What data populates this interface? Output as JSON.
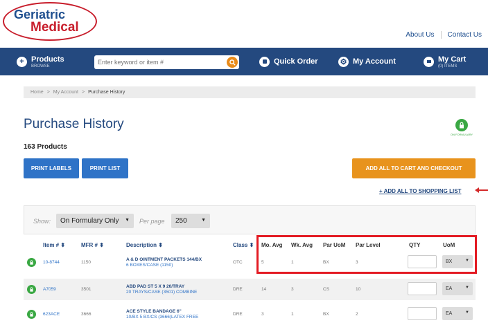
{
  "brand": {
    "line1": "Geriatric",
    "line2": "Medical"
  },
  "top_links": [
    "About Us",
    "Contact Us"
  ],
  "nav": {
    "products": {
      "label": "Products",
      "sub": "BROWSE"
    },
    "search_placeholder": "Enter keyword or item #",
    "quick_order": "Quick Order",
    "my_account": "My Account",
    "my_cart": {
      "label": "My Cart",
      "sub": "(0) ITEMS"
    }
  },
  "breadcrumb": [
    "Home",
    "My Account",
    "Purchase History"
  ],
  "page": {
    "title": "Purchase History",
    "count": "163 Products",
    "formulary_badge": "ON FORMULARY"
  },
  "buttons": {
    "print_labels": "PRINT LABELS",
    "print_list": "PRINT LIST",
    "add_all_checkout": "ADD ALL TO CART AND CHECKOUT",
    "add_all_list": "+ ADD ALL TO SHOPPING LIST"
  },
  "filters": {
    "show_label": "Show:",
    "show_value": "On Formulary Only",
    "per_page_label": "Per page",
    "per_page_value": "250"
  },
  "table": {
    "headers": {
      "item": "Item # ⬍",
      "mfr": "MFR # ⬍",
      "desc": "Description ⬍",
      "class": "Class ⬍",
      "mo_avg": "Mo. Avg",
      "wk_avg": "Wk. Avg",
      "par_uom": "Par UoM",
      "par_level": "Par Level",
      "qty": "QTY",
      "uom": "UoM"
    },
    "rows": [
      {
        "item": "10-8744",
        "mfr": "1150",
        "desc1": "A & D OINTMENT PACKETS 144/BX",
        "desc2": "6 BOXES/CASE (1150)",
        "class": "OTC",
        "mo_avg": "5",
        "wk_avg": "1",
        "par_uom": "BX",
        "par_level": "3",
        "uom": "BX"
      },
      {
        "item": "A7059",
        "mfr": "3501",
        "desc1": "ABD PAD ST 5 X 9 20/TRAY",
        "desc2": "20 TRAYS/CASE (3501) COMBINE",
        "class": "DRE",
        "mo_avg": "14",
        "wk_avg": "3",
        "par_uom": "CS",
        "par_level": "10",
        "uom": "EA"
      },
      {
        "item": "623ACE",
        "mfr": "3666",
        "desc1": "ACE STYLE BANDAGE 6\"",
        "desc2": "10/BX 5 BX/CS (3666)LATEX FREE",
        "class": "DRE",
        "mo_avg": "3",
        "wk_avg": "1",
        "par_uom": "BX",
        "par_level": "2",
        "uom": "EA"
      }
    ]
  },
  "colors": {
    "nav": "#24497f",
    "accent_orange": "#e8931d",
    "button_blue": "#2f73c7",
    "highlight_red": "#e31b23",
    "formulary_green": "#3aa843"
  }
}
